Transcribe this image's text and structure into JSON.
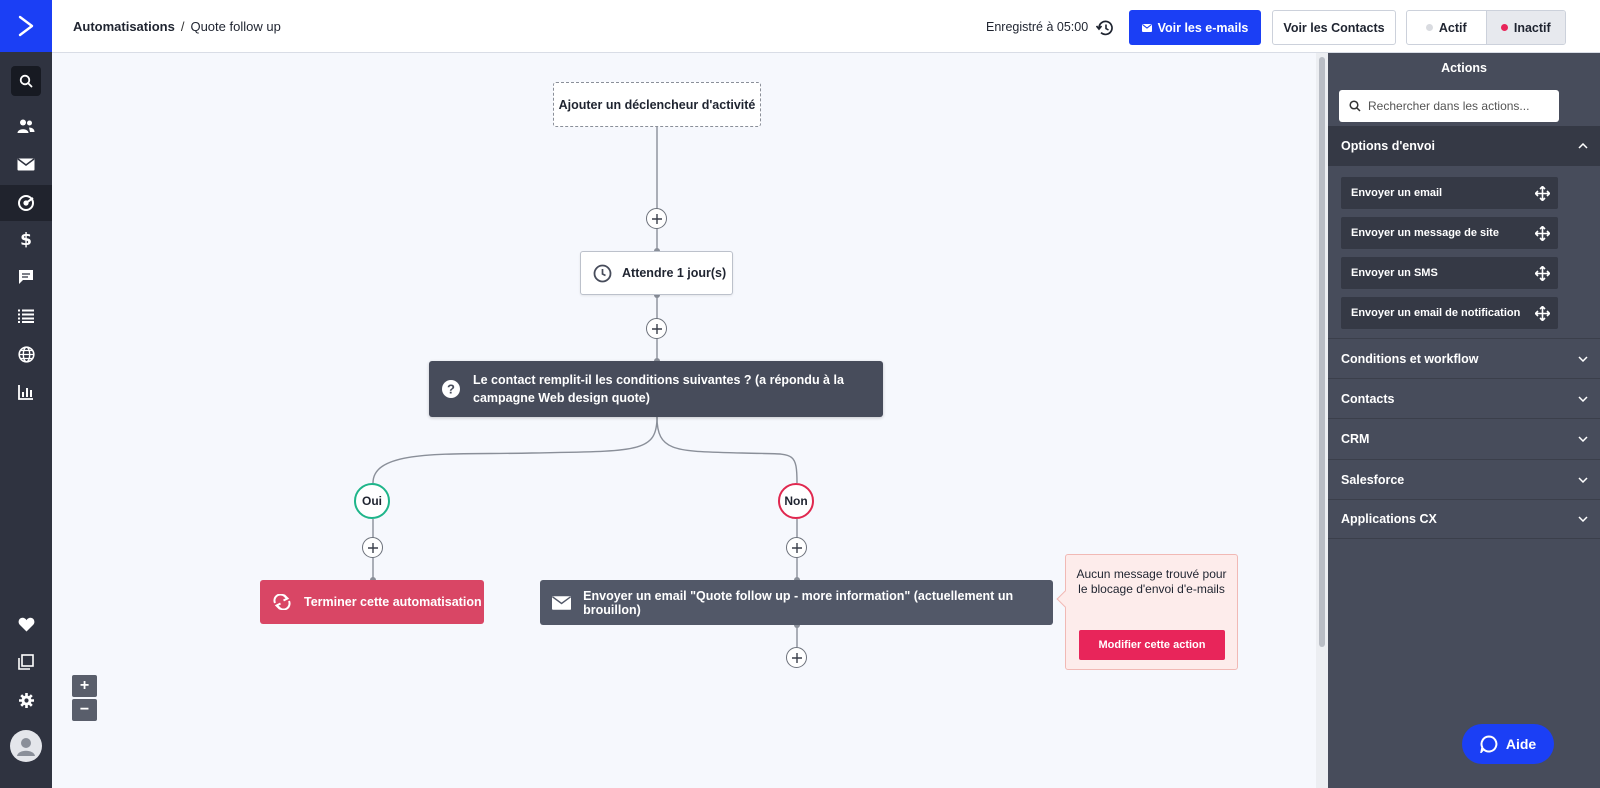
{
  "header": {
    "breadcrumb_root": "Automatisations",
    "breadcrumb_sep": "/",
    "breadcrumb_current": "Quote follow up",
    "saved_text": "Enregistré à 05:00",
    "view_emails_label": "Voir les e-mails",
    "view_contacts_label": "Voir les Contacts",
    "status_active_label": "Actif",
    "status_inactive_label": "Inactif",
    "selected_status": "Inactif"
  },
  "workflow": {
    "trigger_label": "Ajouter un déclencheur d'activité",
    "wait_label": "Attendre 1 jour(s)",
    "condition_label": "Le contact remplit-il les conditions suivantes ? (a répondu à la campagne Web design quote)",
    "yes_label": "Oui",
    "no_label": "Non",
    "end_label": "Terminer cette automatisation",
    "email_label": "Envoyer un email \"Quote follow up - more information\" (actuellement un brouillon)",
    "warning_text": "Aucun message trouvé pour le blocage d'envoi d'e-mails",
    "warning_button": "Modifier cette action",
    "zoom_in": "+",
    "zoom_out": "−"
  },
  "panel": {
    "title": "Actions",
    "search_placeholder": "Rechercher dans les actions...",
    "open_section": "Options d'envoi",
    "send_actions": [
      "Envoyer un email",
      "Envoyer un message de site",
      "Envoyer un SMS",
      "Envoyer un email de notification"
    ],
    "sections": [
      "Conditions et workflow",
      "Contacts",
      "CRM",
      "Salesforce",
      "Applications CX"
    ],
    "help_label": "Aide"
  },
  "colors": {
    "brand_blue": "#1b3ff5",
    "yes_green": "#1fb58a",
    "no_red": "#e0284f",
    "end_node": "#d94665",
    "active_dot": "#d9dbe0",
    "inactive_dot": "#e8255a"
  },
  "icons": {
    "nav": [
      "search-icon",
      "contacts-icon",
      "campaigns-icon",
      "automations-icon",
      "deals-icon",
      "conversations-icon",
      "lists-icon",
      "website-icon",
      "reports-icon",
      "favorites-icon",
      "apps-icon",
      "settings-icon",
      "user-avatar-icon"
    ]
  }
}
